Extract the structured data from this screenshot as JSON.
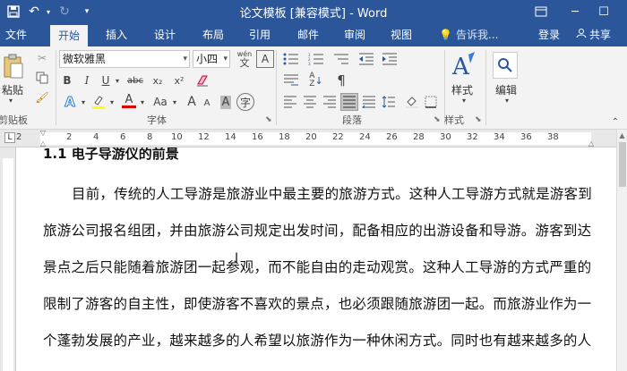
{
  "titlebar": {
    "title": "论文模板 [兼容模式] - Word",
    "save_icon": "save-icon",
    "undo_icon": "undo-icon",
    "redo_icon": "redo-icon",
    "customize_icon": "customize-icon",
    "ribbon_options_icon": "ribbon-display-icon",
    "minimize": "─",
    "maximize": "☐"
  },
  "tabs": {
    "items": [
      "文件",
      "开始",
      "插入",
      "设计",
      "布局",
      "引用",
      "邮件",
      "审阅",
      "视图"
    ],
    "active": "开始",
    "tellme": "告诉我...",
    "signin": "登录",
    "share": "共享"
  },
  "ribbon": {
    "clipboard": {
      "paste": "粘贴",
      "label": "剪贴板"
    },
    "font": {
      "font_name": "微软雅黑",
      "font_size": "小四",
      "bold": "B",
      "italic": "I",
      "underline": "U",
      "strike": "abc",
      "subscript": "x₂",
      "superscript": "x²",
      "font_color": "A",
      "change_case": "Aa",
      "grow": "A",
      "shrink": "A",
      "phonetic": "wén",
      "char_border": "A",
      "circle": "字",
      "label": "字体"
    },
    "paragraph": {
      "label": "段落"
    },
    "styles": {
      "button": "样式",
      "label": "样式"
    },
    "editing": {
      "button": "编辑"
    }
  },
  "ruler": {
    "numbers": [
      "2",
      "2",
      "4",
      "6",
      "8",
      "10",
      "12",
      "14",
      "16",
      "18",
      "20",
      "22",
      "24",
      "26",
      "28",
      "30",
      "32",
      "34",
      "36",
      "38"
    ]
  },
  "document": {
    "heading": "1.1  电子导游仪的前景",
    "lines": [
      "目前，传统的人工导游是旅游业中最主要的旅游方式。这种人工导游方式就是游客到",
      "旅游公司报名组团，并由旅游公司规定出发时间，配备相应的出游设备和导游。游客到达",
      "景点之后只能随着旅游团一起参观，而不能自由的走动观赏。这种人工导游的方式严重的",
      "限制了游客的自主性，即使游客不喜欢的景点，也必须跟随旅游团一起。而旅游业作为一",
      "个蓬勃发展的产业，越来越多的人希望以旅游作为一种休闲方式。同时也有越来越多的人"
    ]
  }
}
